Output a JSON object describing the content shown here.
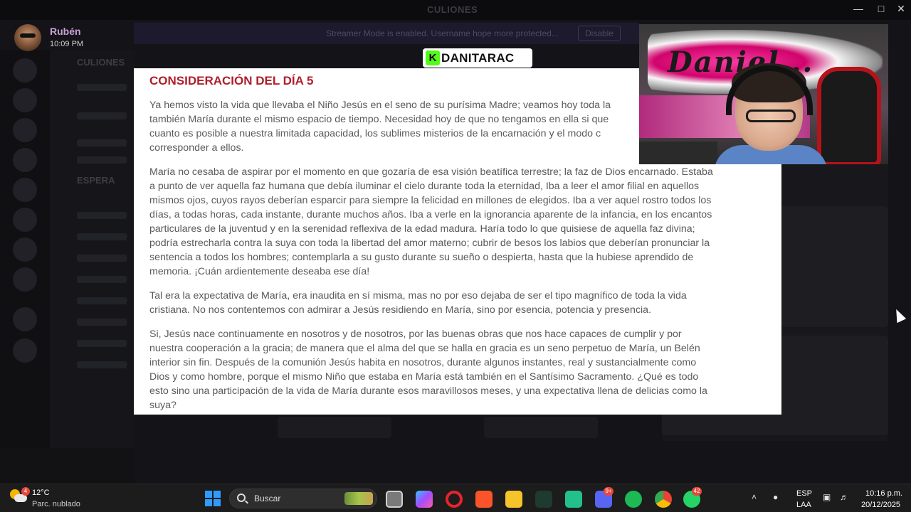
{
  "window": {
    "title": "CULIONES",
    "banner_text": "Streamer Mode is enabled. Username hope more protected...",
    "banner_button": "Disable",
    "server_name": "CULIONES",
    "channel_section": "ESPERA"
  },
  "message": {
    "author": "Rubén",
    "time": "10:09 PM"
  },
  "stream": {
    "platform_icon": "K",
    "channel_name": "DANITARAC"
  },
  "webcam": {
    "graffiti_text": "Daniel..."
  },
  "document": {
    "title": "CONSIDERACIÓN DEL DÍA 5",
    "paragraphs": [
      {
        "lines": [
          "Ya hemos visto la vida que llevaba el Niño Jesús en el seno de su purísima Madre; veamos hoy toda la",
          "también María durante el mismo espacio de tiempo. Necesidad hoy de que no tengamos en ella si que",
          "cuanto es posible a nuestra limitada capacidad, los sublimes misterios de la encarnación y el modo c",
          "corresponder a ellos."
        ]
      },
      {
        "lines": [
          "María no cesaba de aspirar por el momento en que gozaría de esa visión beatífica terrestre; la faz de Dios encarnado. Estaba",
          "a punto de ver aquella faz humana que debía iluminar el cielo durante toda la eternidad, Iba a leer el amor filial en aquellos",
          "mismos ojos, cuyos rayos deberían esparcir para siempre la felicidad en millones de elegidos. Iba a ver aquel rostro todos los",
          "días, a todas horas, cada instante, durante muchos años. Iba a verle en la ignorancia aparente de la infancia, en los encantos",
          "particulares de la juventud y en la serenidad reflexiva de la edad madura. Haría todo lo que quisiese de aquella faz divina;",
          "podría estrecharla contra la suya con toda la libertad del amor materno; cubrir de besos los labios que deberían pronunciar la",
          "sentencia a todos los hombres; contemplarla a su gusto durante su sueño o despierta, hasta que la hubiese aprendido de",
          "memoria. ¡Cuán ardientemente deseaba ese día!"
        ]
      },
      {
        "lines": [
          "Tal era la expectativa de María, era inaudita en sí misma, mas no por eso dejaba de ser el tipo magnífico de toda la vida",
          "cristiana. No nos contentemos con admirar a Jesús residiendo en María, sino por esencia, potencia y presencia."
        ]
      },
      {
        "lines": [
          "Si, Jesús nace continuamente en nosotros y de nosotros, por las buenas obras que nos hace capaces de cumplir y por",
          "nuestra cooperación a la gracia; de manera que el alma del que se halla en gracia es un seno perpetuo de María, un Belén",
          "interior sin fin. Después de la comunión Jesús habita en nosotros, durante algunos instantes, real y sustancialmente como",
          "Dios y como hombre, porque el mismo Niño que estaba en María está también en el Santísimo Sacramento. ¿Qué es todo",
          "esto sino una participación de la vida de María durante esos maravillosos meses, y una expectativa llena de delicias como la",
          "suya?"
        ]
      }
    ]
  },
  "taskbar": {
    "weather_badge": "4",
    "temperature": "12°C",
    "condition": "Parc. nublado",
    "search_placeholder": "Buscar",
    "discord_badge": "9+",
    "whatsapp_badge": "42",
    "language_line1": "ESP",
    "language_line2": "LAA",
    "time": "10:16 p.m.",
    "date": "20/12/2025"
  },
  "colors": {
    "doc_title": "#b01e2c",
    "kick_green": "#53fc18",
    "taskbar": "#1c1c1c"
  }
}
